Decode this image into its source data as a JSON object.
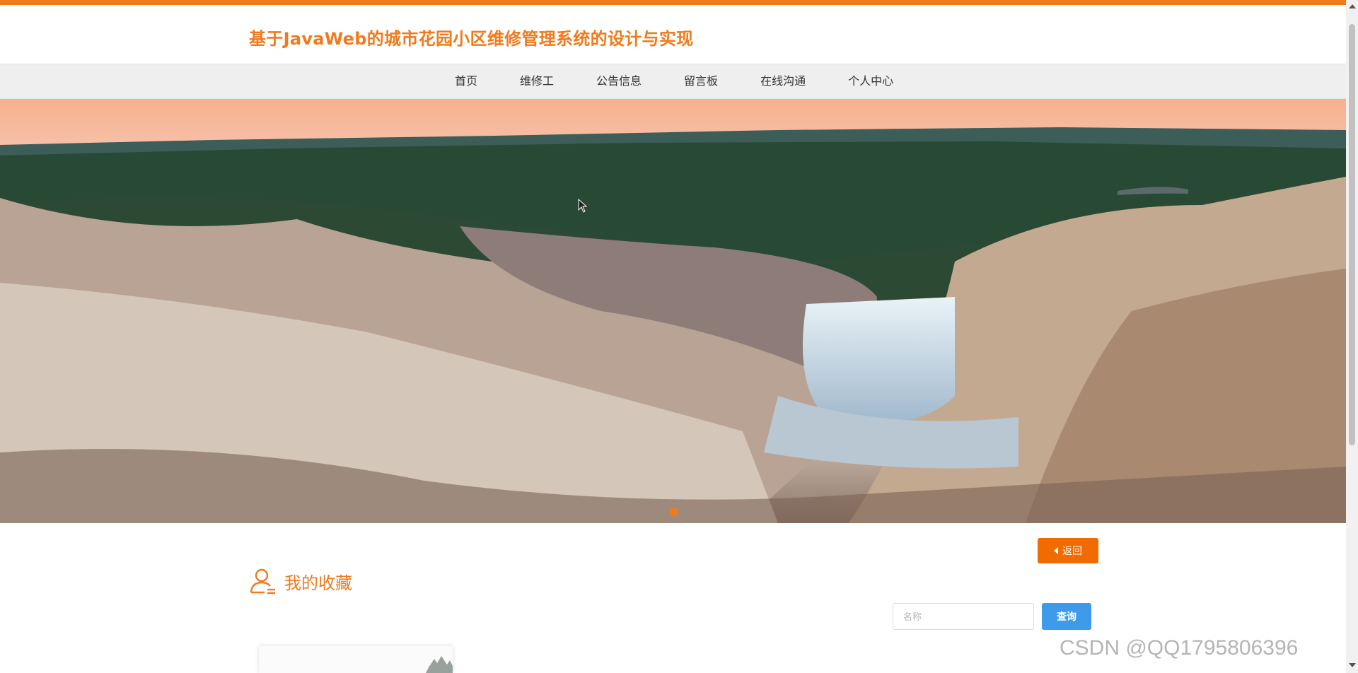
{
  "header": {
    "title": "基于JavaWeb的城市花园小区维修管理系统的设计与实现"
  },
  "nav": {
    "items": [
      "首页",
      "维修工",
      "公告信息",
      "留言板",
      "在线沟通",
      "个人中心"
    ]
  },
  "banner": {
    "active_slide": 1,
    "slide_count": 1
  },
  "actions": {
    "back_label": "返回"
  },
  "section": {
    "title": "我的收藏"
  },
  "search": {
    "placeholder": "名称",
    "value": "",
    "button_label": "查询"
  },
  "watermark": "CSDN @QQ1795806396",
  "colors": {
    "accent": "#f07a1c",
    "query_button": "#3d9be9",
    "nav_bg": "#efefef"
  }
}
